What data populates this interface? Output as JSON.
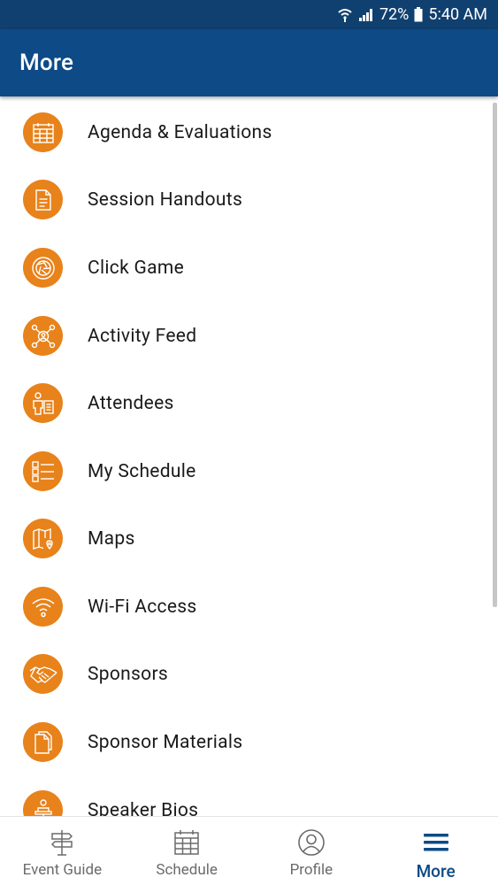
{
  "status_bar": {
    "battery": "72%",
    "time": "5:40 AM"
  },
  "header": {
    "title": "More"
  },
  "menu": {
    "items": [
      {
        "label": "Agenda & Evaluations",
        "icon": "calendar-icon"
      },
      {
        "label": "Session Handouts",
        "icon": "document-icon"
      },
      {
        "label": "Click Game",
        "icon": "aperture-icon"
      },
      {
        "label": "Activity Feed",
        "icon": "activity-network-icon"
      },
      {
        "label": "Attendees",
        "icon": "attendees-icon"
      },
      {
        "label": "My Schedule",
        "icon": "schedule-list-icon"
      },
      {
        "label": "Maps",
        "icon": "map-icon"
      },
      {
        "label": "Wi-Fi Access",
        "icon": "wifi-icon"
      },
      {
        "label": "Sponsors",
        "icon": "handshake-icon"
      },
      {
        "label": "Sponsor Materials",
        "icon": "files-icon"
      },
      {
        "label": "Speaker Bios",
        "icon": "speaker-icon"
      }
    ]
  },
  "tab_bar": {
    "tabs": [
      {
        "label": "Event Guide",
        "icon": "signpost-icon"
      },
      {
        "label": "Schedule",
        "icon": "calendar-grid-icon"
      },
      {
        "label": "Profile",
        "icon": "profile-icon"
      },
      {
        "label": "More",
        "icon": "hamburger-menu-icon",
        "active": true
      }
    ]
  },
  "colors": {
    "status_bar": "#10406f",
    "app_bar": "#0d4a86",
    "icon_accent": "#e8821a",
    "active_tab": "#0d4a86"
  }
}
